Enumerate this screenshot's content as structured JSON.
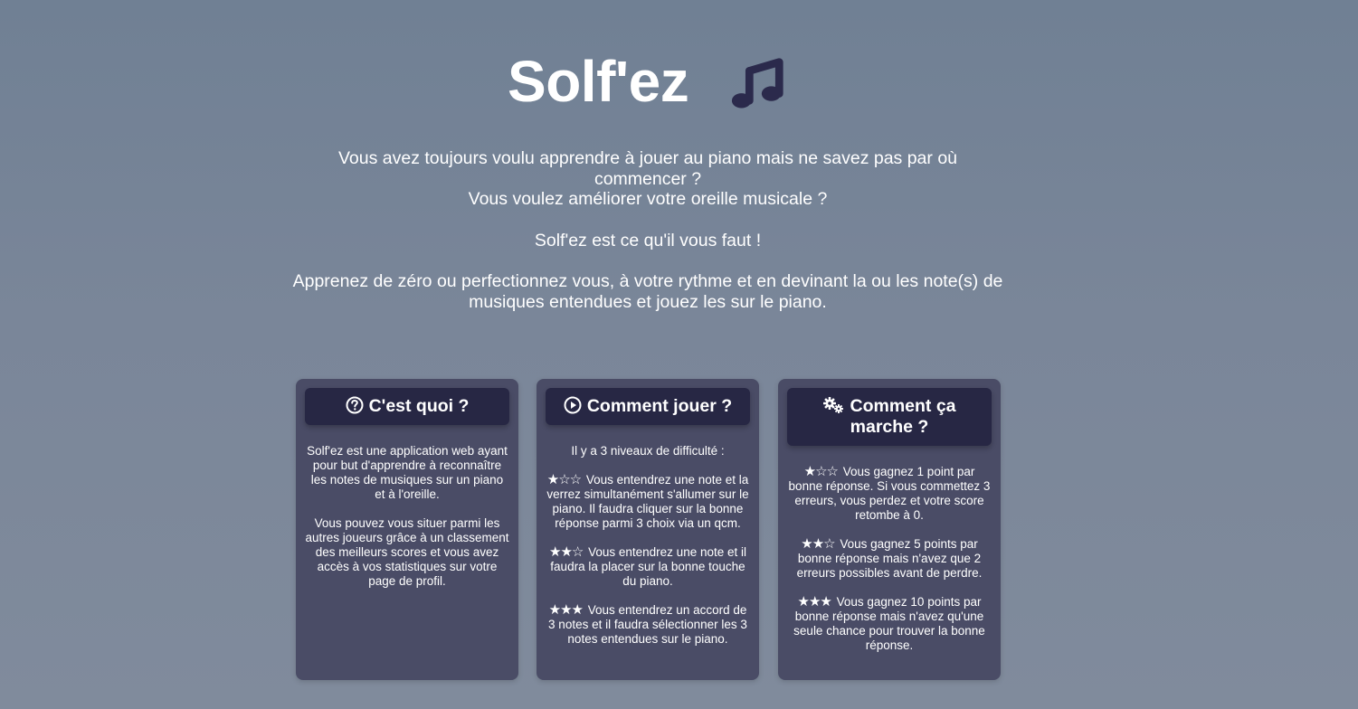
{
  "hero": {
    "title": "Solf'ez",
    "icon": "music-note-icon"
  },
  "intro": {
    "line1": "Vous avez toujours voulu apprendre à jouer au piano mais ne savez pas par où commencer ?",
    "line2": "Vous voulez améliorer votre oreille musicale ?",
    "line3": "Solf'ez est ce qu'il vous faut !",
    "line4": "Apprenez de zéro ou perfectionnez vous, à votre rythme et en devinant la ou les note(s) de musiques entendues et jouez les sur le piano."
  },
  "cards": {
    "what": {
      "icon": "question-circle-icon",
      "title": "C'est quoi ?",
      "p1": "Solf'ez est une application web ayant pour but d'apprendre à reconnaître les notes de musiques sur un piano et à l'oreille.",
      "p2": "Vous pouvez vous situer parmi les autres joueurs grâce à un classement des meilleurs scores et vous avez accès à vos statistiques sur votre page de profil."
    },
    "how_play": {
      "icon": "play-circle-icon",
      "title": "Comment jouer ?",
      "intro": "Il y a 3 niveaux de difficulté :",
      "level1_stars": "★☆☆",
      "level1": "Vous entendrez une note et la verrez simultanément s'allumer sur le piano. Il faudra cliquer sur la bonne réponse parmi 3 choix via un qcm.",
      "level2_stars": "★★☆",
      "level2": "Vous entendrez une note et il faudra la placer sur la bonne touche du piano.",
      "level3_stars": "★★★",
      "level3": "Vous entendrez un accord de 3 notes et il faudra sélectionner les 3 notes entendues sur le piano."
    },
    "how_works": {
      "icon": "gears-icon",
      "title": "Comment ça marche ?",
      "level1_stars": "★☆☆",
      "level1": "Vous gagnez 1 point par bonne réponse. Si vous commettez 3 erreurs, vous perdez et votre score retombe à 0.",
      "level2_stars": "★★☆",
      "level2": "Vous gagnez 5 points par bonne réponse mais n'avez que 2 erreurs possibles avant de perdre.",
      "level3_stars": "★★★",
      "level3": "Vous gagnez 10 points par bonne réponse mais n'avez qu'une seule chance pour trouver la bonne réponse."
    }
  },
  "colors": {
    "card_bg": "#4a4c66",
    "card_header_bg": "#272744",
    "icon_dark": "#2b2a4c"
  }
}
